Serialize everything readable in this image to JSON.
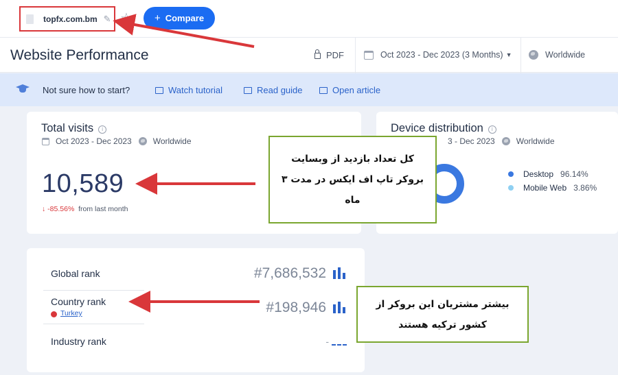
{
  "topbar": {
    "domain": "topfx.com.bm",
    "compare_label": "Compare",
    "compare_plus": "+"
  },
  "header": {
    "title": "Website Performance",
    "pdf_label": "PDF",
    "date_range": "Oct 2023 - Dec 2023 (3 Months)",
    "region": "Worldwide"
  },
  "tutorial_bar": {
    "prompt": "Not sure how to start?",
    "links": [
      "Watch tutorial",
      "Read guide",
      "Open article"
    ]
  },
  "total_visits": {
    "title": "Total visits",
    "period": "Oct 2023 - Dec 2023",
    "region": "Worldwide",
    "value": "10,589",
    "change_arrow": "↓",
    "change": "-85.56%",
    "change_suffix": "from last month"
  },
  "device_distribution": {
    "title": "Device distribution",
    "period_partial": "3 - Dec 2023",
    "region": "Worldwide",
    "items": [
      {
        "label": "Desktop",
        "value": "96.14%",
        "color": "#3a78e0"
      },
      {
        "label": "Mobile Web",
        "value": "3.86%",
        "color": "#8fd0f2"
      }
    ],
    "desktop_share": 0.9614
  },
  "ranks": {
    "global_label": "Global rank",
    "global_value": "#7,686,532",
    "country_label": "Country rank",
    "country_value": "#198,946",
    "country_name": "Turkey",
    "industry_label": "Industry rank",
    "industry_value": "-"
  },
  "annotations": {
    "callout1": "کل تعداد بازدید از وبسایت بروکر تاپ اف ایکس در مدت ۳ ماه",
    "callout2": "بیشتر مشتریان این بروکر از کشور ترکیه هستند",
    "accent_red": "#d9373a",
    "accent_green": "#7aa62f"
  }
}
